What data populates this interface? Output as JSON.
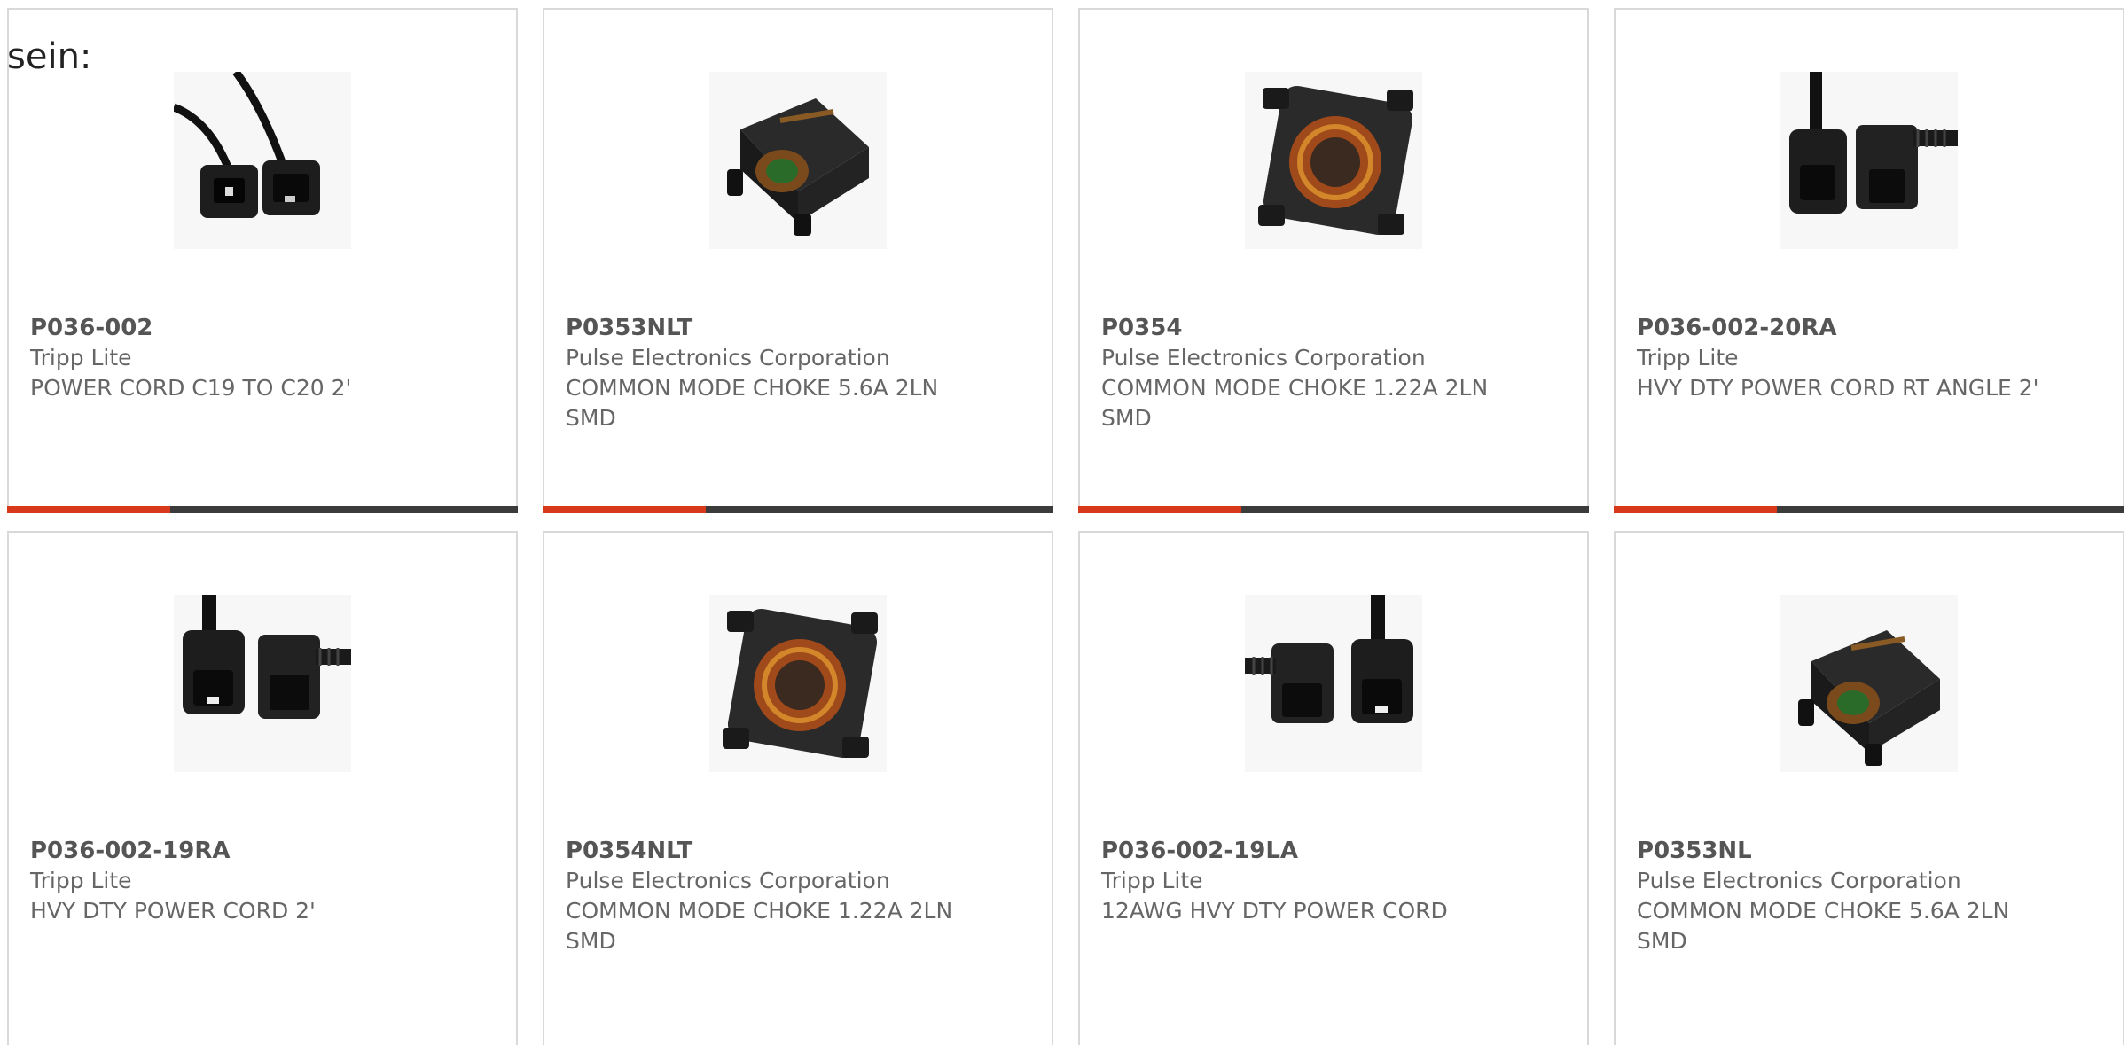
{
  "intro": {
    "text": "sein:"
  },
  "colors": {
    "accent": "#d9391b",
    "bar": "#3b3b3b",
    "border": "#d9d9d9"
  },
  "products": [
    {
      "part": "P036-002",
      "maker": "Tripp Lite",
      "description": "POWER CORD C19 TO C20 2'",
      "image": "power-cord-c19-c20"
    },
    {
      "part": "P0353NLT",
      "maker": "Pulse Electronics Corporation",
      "description": "COMMON MODE CHOKE 5.6A 2LN SMD",
      "image": "smd-choke"
    },
    {
      "part": "P0354",
      "maker": "Pulse Electronics Corporation",
      "description": "COMMON MODE CHOKE 1.22A 2LN SMD",
      "image": "toroid-choke"
    },
    {
      "part": "P036-002-20RA",
      "maker": "Tripp Lite",
      "description": "HVY DTY POWER CORD RT ANGLE 2'",
      "image": "power-cord-right-angle"
    },
    {
      "part": "P036-002-19RA",
      "maker": "Tripp Lite",
      "description": "HVY DTY POWER CORD 2'",
      "image": "power-cord-right-angle"
    },
    {
      "part": "P0354NLT",
      "maker": "Pulse Electronics Corporation",
      "description": "COMMON MODE CHOKE 1.22A 2LN SMD",
      "image": "toroid-choke"
    },
    {
      "part": "P036-002-19LA",
      "maker": "Tripp Lite",
      "description": "12AWG HVY DTY POWER CORD",
      "image": "power-cord-left-angle"
    },
    {
      "part": "P0353NL",
      "maker": "Pulse Electronics Corporation",
      "description": "COMMON MODE CHOKE 5.6A 2LN SMD",
      "image": "smd-choke"
    }
  ]
}
